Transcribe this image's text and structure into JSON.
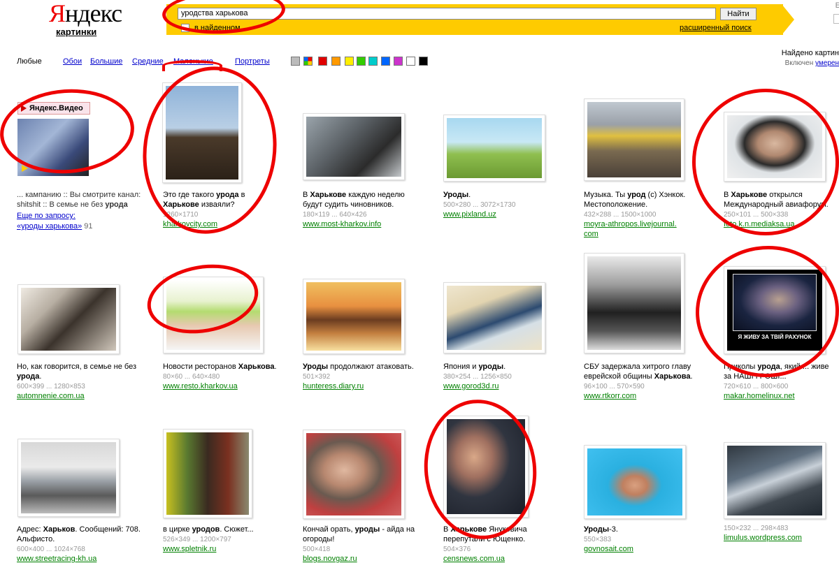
{
  "header": {
    "logo_first": "Я",
    "logo_rest": "ндекс",
    "service": "картинки",
    "query": "уродства харькова",
    "search_button": "Найти",
    "in_found": "в найденном",
    "advanced": "расширенный поиск",
    "top_right": "Е",
    "found_text": "Найдено картин",
    "enabled_text": "Включен ",
    "enabled_link": "умерен"
  },
  "filters": {
    "any": "Любые",
    "items": [
      "Обои",
      "Большие",
      "Средние",
      "Маленькие",
      "Портреты"
    ]
  },
  "colors": [
    "#bbbbbb",
    "multicolor",
    "#e00000",
    "#ff9900",
    "#ffee00",
    "#33cc00",
    "#00cccc",
    "#0066ff",
    "#cc33cc",
    "#ffffff",
    "#000000"
  ],
  "video": {
    "label": "Яндекс.Видео",
    "line1": "... кампанию :: Вы смотрите канал:",
    "line2": "shitshit :: В семье не без ",
    "line2_b": "урода",
    "more1": "Еще по запросу:",
    "more2": "«уроды харькова»",
    "count": "91"
  },
  "results": [
    {
      "t1": "Это где такого ",
      "b1": "урода",
      "t2": " в",
      "line2_b": "Харькове",
      "line2": " изваяли?",
      "size": "1260×1710",
      "url": "kharkovcity.com"
    },
    {
      "t1": "В ",
      "b1": "Харькове",
      "t2": " каждую неделю",
      "line2": "будут судить чиновников.",
      "size": "180×119 ... 640×426",
      "url": "www.most-kharkov.info"
    },
    {
      "t1": "",
      "b1": "Уроды",
      "t2": ".",
      "size": "500×280 ... 3072×1730",
      "url": "www.pixland.uz"
    },
    {
      "t1": "Музыка. Ты ",
      "b1": "урод",
      "t2": " (c) Хэнкок.",
      "line2": "Местоположение.",
      "size": "432×288 ... 1500×1000",
      "url": "moyra-athropos.livejournal.",
      "url2": "com"
    },
    {
      "t1": "В ",
      "b1": "Харькове",
      "t2": " открылся",
      "line2": "Международный авиафорум.",
      "size": "250×101 ... 500×338",
      "url": "foto.k.n.mediaksa.ua"
    },
    {
      "t1": "Но, как говорится, в семье не без",
      "line2_b": "урода",
      "line2": ".",
      "size": "600×399 ... 1280×853",
      "url": "automnenie.com.ua"
    },
    {
      "t1": "Новости ресторанов ",
      "b1": "Харькова",
      "t2": ".",
      "size": "80×60 ... 640×480",
      "url": "www.resto.kharkov.ua"
    },
    {
      "t1": "",
      "b1": "Уроды",
      "t2": " продолжают атаковать.",
      "size": "501×392",
      "url": "hunteress.diary.ru"
    },
    {
      "t1": "Япония и ",
      "b1": "уроды",
      "t2": ".",
      "size": "380×254 ... 1256×850",
      "url": "www.gorod3d.ru"
    },
    {
      "t1": "СБУ задержала хитрого главу",
      "line2": "еврейской общины ",
      "line2_b2": "Харькова",
      "line2_end": ".",
      "size": "96×100 ... 570×590",
      "url": "www.rtkorr.com"
    },
    {
      "t1": "Приколы ",
      "b1": "урода",
      "t2": ", який ... живе",
      "line2": "за НАШІ ГРОШІ...",
      "size": "720×610 ... 800×600",
      "url": "makar.homelinux.net"
    },
    {
      "t1": "Адрес: ",
      "b1": "Харьков",
      "t2": ". Сообщений: 708.",
      "line2": "Альфисто.",
      "size": "600×400 ... 1024×768",
      "url": "www.streetracing-kh.ua"
    },
    {
      "t1": "в цирке ",
      "b1": "уродов",
      "t2": ". Сюжет...",
      "size": "526×349 ... 1200×797",
      "url": "www.spletnik.ru"
    },
    {
      "t1": "Кончай орать, ",
      "b1": "уроды",
      "t2": " - айда на",
      "line2": "огороды!",
      "size": "500×418",
      "url": "blogs.novgaz.ru"
    },
    {
      "t1": "В ",
      "b1": "Харькове",
      "t2": " Януковича",
      "line2": "перепутали с Ющенко.",
      "size": "504×376",
      "url": "censnews.com.ua"
    },
    {
      "t1": "",
      "b1": "Уроды",
      "t2": "-3.",
      "size": "550×383",
      "url": "govnosait.com"
    },
    {
      "t1": "",
      "size": "150×232 ... 298×483",
      "url": "limulus.wordpress.com"
    }
  ],
  "poster_text": "Я ЖИВУ ЗА ТВІЙ РАХУНОК"
}
